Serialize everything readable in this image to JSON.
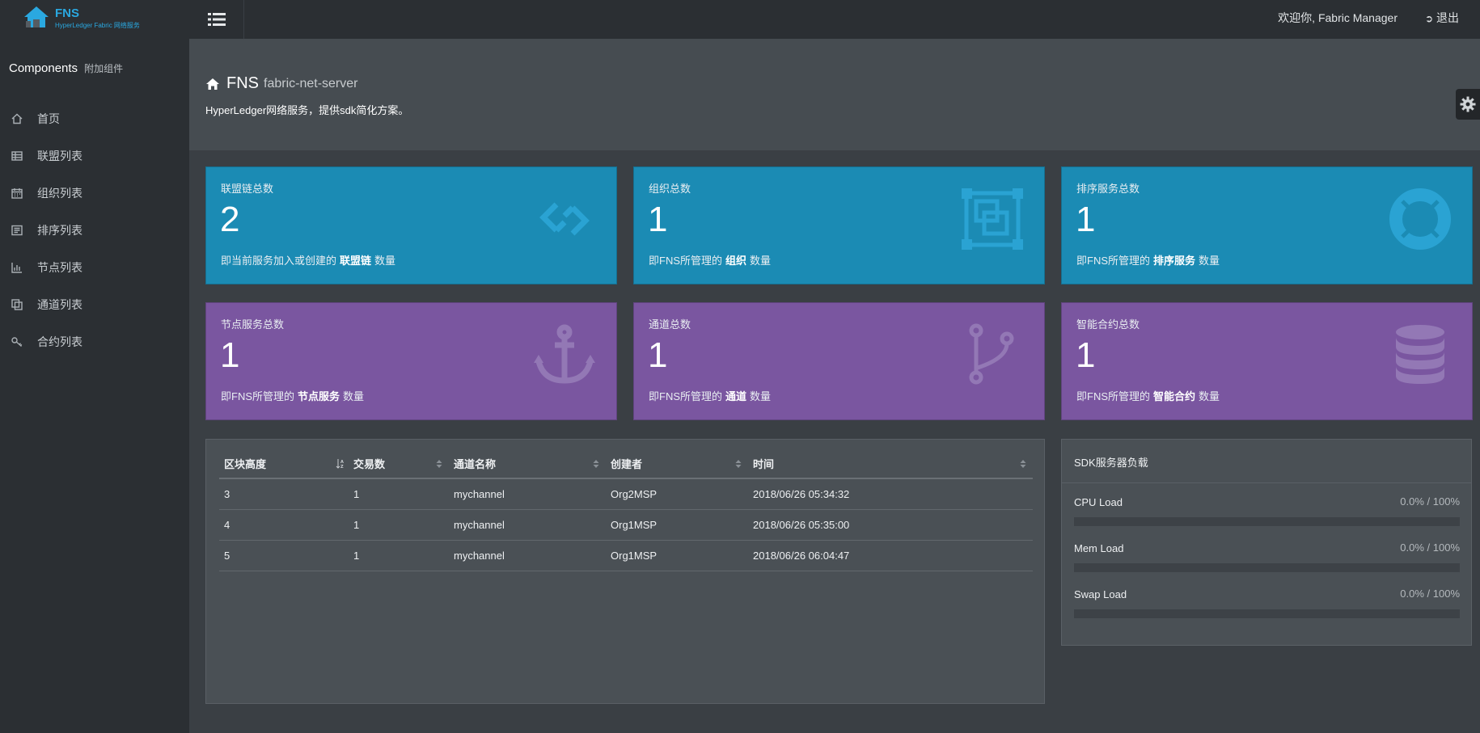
{
  "brand": {
    "name": "FNS",
    "sub": "HyperLedger Fabric 网络服务"
  },
  "sidebar": {
    "components_label": "Components",
    "components_sub": "附加组件",
    "items": [
      {
        "label": "首页",
        "icon": "home-icon"
      },
      {
        "label": "联盟列表",
        "icon": "table-icon"
      },
      {
        "label": "组织列表",
        "icon": "calendar-icon"
      },
      {
        "label": "排序列表",
        "icon": "list-icon"
      },
      {
        "label": "节点列表",
        "icon": "bar-chart-icon"
      },
      {
        "label": "通道列表",
        "icon": "copy-icon"
      },
      {
        "label": "合约列表",
        "icon": "key-icon"
      }
    ]
  },
  "topbar": {
    "welcome": "欢迎你, Fabric Manager",
    "logout": "退出"
  },
  "header": {
    "title": "FNS",
    "subtitle": "fabric-net-server",
    "description": "HyperLedger网络服务，提供sdk简化方案。"
  },
  "stats": [
    {
      "label": "联盟链总数",
      "value": "2",
      "desc_pre": "即当前服务加入或创建的",
      "desc_bold": "联盟链",
      "desc_post": "数量",
      "icon": "link-icon"
    },
    {
      "label": "组织总数",
      "value": "1",
      "desc_pre": "即FNS所管理的",
      "desc_bold": "组织",
      "desc_post": "数量",
      "icon": "object-group-icon"
    },
    {
      "label": "排序服务总数",
      "value": "1",
      "desc_pre": "即FNS所管理的",
      "desc_bold": "排序服务",
      "desc_post": "数量",
      "icon": "life-ring-icon"
    },
    {
      "label": "节点服务总数",
      "value": "1",
      "desc_pre": "即FNS所管理的",
      "desc_bold": "节点服务",
      "desc_post": "数量",
      "icon": "anchor-icon"
    },
    {
      "label": "通道总数",
      "value": "1",
      "desc_pre": "即FNS所管理的",
      "desc_bold": "通道",
      "desc_post": "数量",
      "icon": "code-fork-icon"
    },
    {
      "label": "智能合约总数",
      "value": "1",
      "desc_pre": "即FNS所管理的",
      "desc_bold": "智能合约",
      "desc_post": "数量",
      "icon": "database-icon"
    }
  ],
  "colors": {
    "blue": "#1b8bb4",
    "purple": "#7a56a0",
    "sidebar": "#2b2f33"
  },
  "table": {
    "headers": [
      "区块高度",
      "交易数",
      "通道名称",
      "创建者",
      "时间"
    ],
    "rows": [
      [
        "3",
        "1",
        "mychannel",
        "Org2MSP",
        "2018/06/26 05:34:32"
      ],
      [
        "4",
        "1",
        "mychannel",
        "Org1MSP",
        "2018/06/26 05:35:00"
      ],
      [
        "5",
        "1",
        "mychannel",
        "Org1MSP",
        "2018/06/26 06:04:47"
      ]
    ]
  },
  "load": {
    "title": "SDK服务器负载",
    "items": [
      {
        "name": "CPU Load",
        "value": "0.0% / 100%",
        "fraction": 0
      },
      {
        "name": "Mem Load",
        "value": "0.0% / 100%",
        "fraction": 0
      },
      {
        "name": "Swap Load",
        "value": "0.0% / 100%",
        "fraction": 0
      }
    ]
  }
}
